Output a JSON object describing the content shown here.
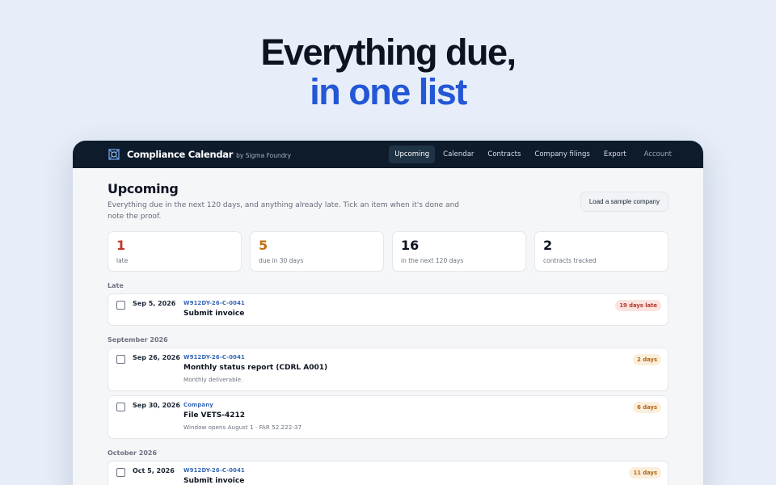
{
  "hero": {
    "line1": "Everything due,",
    "line2": "in one list"
  },
  "app": {
    "name": "Compliance Calendar",
    "by": "by Sigma Foundry",
    "nav": [
      {
        "label": "Upcoming",
        "active": true
      },
      {
        "label": "Calendar"
      },
      {
        "label": "Contracts"
      },
      {
        "label": "Company filings"
      },
      {
        "label": "Export"
      },
      {
        "label": "Account"
      }
    ]
  },
  "page": {
    "title": "Upcoming",
    "description": "Everything due in the next 120 days, and anything already late. Tick an item when it's done and note the proof.",
    "sample_button": "Load a sample company"
  },
  "stats": [
    {
      "value": "1",
      "label": "late",
      "color": "#c2352b"
    },
    {
      "value": "5",
      "label": "due in 30 days",
      "color": "#c2700f"
    },
    {
      "value": "16",
      "label": "in the next 120 days"
    },
    {
      "value": "2",
      "label": "contracts tracked"
    }
  ],
  "groups": [
    {
      "label": "Late",
      "items": [
        {
          "date": "Sep 5, 2026",
          "tag": "W912DY-26-C-0041",
          "title": "Submit invoice",
          "badge": "19 days late",
          "badge_type": "late"
        }
      ]
    },
    {
      "label": "September 2026",
      "items": [
        {
          "date": "Sep 26, 2026",
          "tag": "W912DY-26-C-0041",
          "title": "Monthly status report (CDRL A001)",
          "note": "Monthly deliverable.",
          "badge": "2 days",
          "badge_type": "soon"
        },
        {
          "date": "Sep 30, 2026",
          "tag": "Company",
          "title": "File VETS-4212",
          "note": "Window opens August 1 · FAR 52.222-37",
          "badge": "6 days",
          "badge_type": "soon"
        }
      ]
    },
    {
      "label": "October 2026",
      "items": [
        {
          "date": "Oct 5, 2026",
          "tag": "W912DY-26-C-0041",
          "title": "Submit invoice",
          "badge": "11 days",
          "badge_type": "soon"
        }
      ]
    }
  ],
  "colors": {
    "accent": "#2357d6",
    "topbar": "#0e1b2b",
    "late": "#c2352b",
    "soon": "#c2700f"
  }
}
